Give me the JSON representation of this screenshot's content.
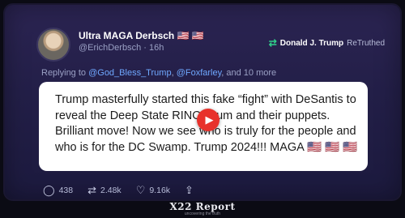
{
  "post": {
    "display_name": "Ultra MAGA Derbsch 🇺🇸 🇺🇸",
    "handle": "@ErichDerbsch",
    "time_sep": " · ",
    "time": "16h",
    "retruth": {
      "icon": "retruth-icon",
      "user": "Donald J. Trump",
      "label": "ReTruthed"
    },
    "reply": {
      "prefix": "Replying to ",
      "mentions": [
        "@God_Bless_Trump",
        "@Foxfarley"
      ],
      "sep": ", ",
      "suffix": ", and 10 more"
    },
    "text": "Trump masterfully started this fake “fight” with DeSantis to reveal the Deep State RINO scum and their puppets. Brilliant move! Now we see who is truly for the people and who is for the DC Swamp. Trump 2024!!! MAGA 🇺🇸 🇺🇸 🇺🇸",
    "stats": {
      "replies": "438",
      "retruths": "2.48k",
      "likes": "9.16k"
    }
  },
  "footer": {
    "logo": "X22 Report",
    "tagline": "uncovering the truth"
  },
  "colors": {
    "background": "#231f48",
    "accent_green": "#2fd08a",
    "mention_blue": "#6fa8ff",
    "play_red": "#e8312b"
  }
}
